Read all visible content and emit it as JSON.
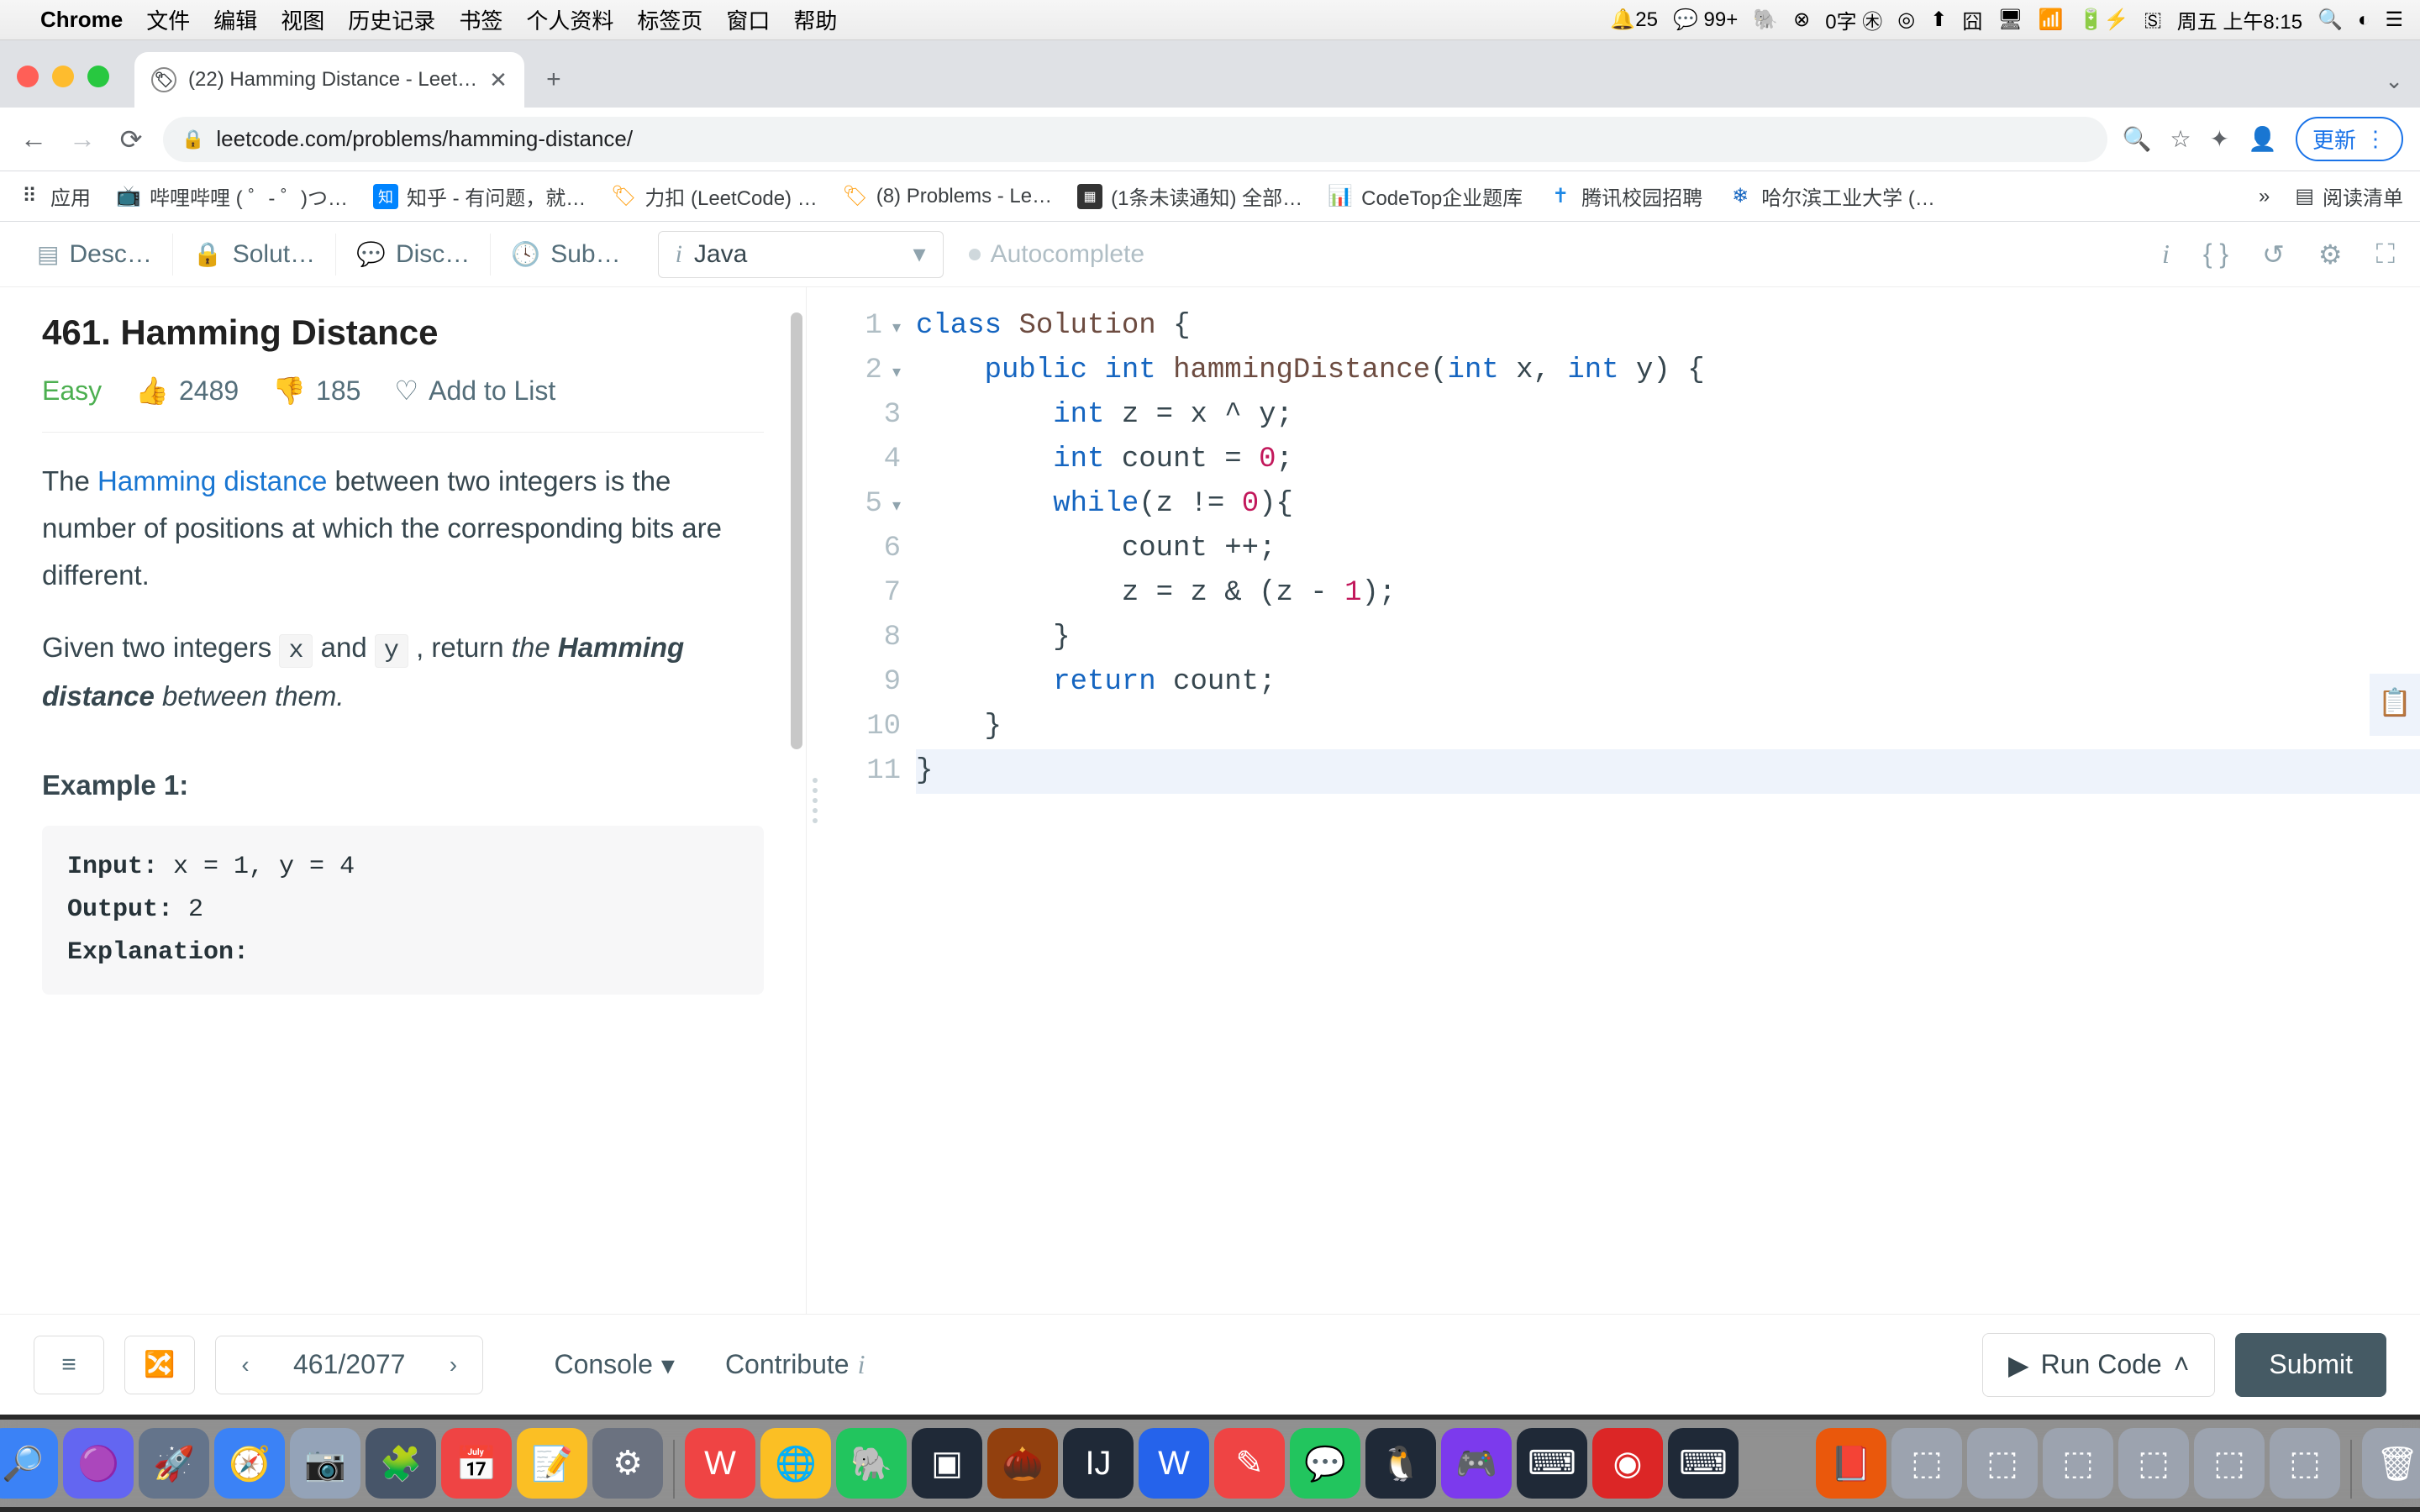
{
  "mac_menu": {
    "app": "Chrome",
    "items": [
      "文件",
      "编辑",
      "视图",
      "历史记录",
      "书签",
      "个人资料",
      "标签页",
      "窗口",
      "帮助"
    ],
    "right": [
      "🔔25",
      "💬 99+",
      "🐘",
      "⊗",
      "0字 ㊍",
      "◎",
      "⬆",
      "囧",
      "🖥",
      "📶",
      "🔋⚡",
      "🇸",
      "周五 上午8:15",
      "🔍",
      "◐",
      "☰"
    ]
  },
  "tab": {
    "title": "(22) Hamming Distance - Leet…"
  },
  "url": "leetcode.com/problems/hamming-distance/",
  "update_label": "更新",
  "bookmarks": [
    {
      "ico": "⠿",
      "label": "应用"
    },
    {
      "ico": "📺",
      "label": "哔哩哔哩 (  ゜- ゜)つ…"
    },
    {
      "ico": "知",
      "label": "知乎 - 有问题，就…"
    },
    {
      "ico": "🏷",
      "label": "力扣 (LeetCode) …"
    },
    {
      "ico": "🏷",
      "label": "(8) Problems - Le…"
    },
    {
      "ico": "▦",
      "label": "(1条未读通知) 全部…"
    },
    {
      "ico": "📊",
      "label": "CodeTop企业题库"
    },
    {
      "ico": "✝",
      "label": "腾讯校园招聘"
    },
    {
      "ico": "❄",
      "label": "哈尔滨工业大学 (…"
    }
  ],
  "bm_more": "»",
  "readlist": "阅读清单",
  "lc_tabs": {
    "desc": "Desc…",
    "solut": "Solut…",
    "disc": "Disc…",
    "sub": "Sub…"
  },
  "lang": "Java",
  "autocomplete": "Autocomplete",
  "problem": {
    "title": "461. Hamming Distance",
    "difficulty": "Easy",
    "likes": "2489",
    "dislikes": "185",
    "addlist": "Add to List",
    "p1_pre": "The ",
    "p1_link": "Hamming distance",
    "p1_post": " between two integers is the number of positions at which the corresponding bits are different.",
    "p2_a": "Given two integers ",
    "p2_x": "x",
    "p2_b": " and ",
    "p2_y": "y",
    "p2_c": " , return ",
    "p2_em1": "the ",
    "p2_strong": "Hamming distance",
    "p2_em2": " between them.",
    "example_h": "Example 1:",
    "ex_input_l": "Input:",
    "ex_input_v": " x = 1, y = 4",
    "ex_output_l": "Output:",
    "ex_output_v": " 2",
    "ex_expl_l": "Explanation:"
  },
  "code_lines": [
    {
      "n": "1",
      "fold": true,
      "html": "<span class='k-blue'>class</span> <span class='k-brown'>Solution</span> {"
    },
    {
      "n": "2",
      "fold": true,
      "html": "    <span class='k-blue'>public</span> <span class='k-blue'>int</span> <span class='k-brown'>hammingDistance</span>(<span class='k-blue'>int</span> x, <span class='k-blue'>int</span> y) {"
    },
    {
      "n": "3",
      "html": "        <span class='k-blue'>int</span> z = x ^ y;"
    },
    {
      "n": "4",
      "html": "        <span class='k-blue'>int</span> count = <span class='num'>0</span>;"
    },
    {
      "n": "5",
      "fold": true,
      "html": "        <span class='k-blue'>while</span>(z != <span class='num'>0</span>){"
    },
    {
      "n": "6",
      "html": "            count ++;"
    },
    {
      "n": "7",
      "html": "            z = z &amp; (z - <span class='num'>1</span>);"
    },
    {
      "n": "8",
      "html": "        }"
    },
    {
      "n": "9",
      "html": "        <span class='k-blue'>return</span> count;"
    },
    {
      "n": "10",
      "html": "    }"
    },
    {
      "n": "11",
      "hl": true,
      "html": "}"
    }
  ],
  "bottom": {
    "counter": "461/2077",
    "console": "Console",
    "contribute": "Contribute",
    "run": "Run Code",
    "submit": "Submit"
  },
  "dock_apps": [
    "🔎",
    "🟣",
    "🚀",
    "🧭",
    "📷",
    "🧩",
    "📅",
    "📝",
    "⚙",
    "|",
    "W",
    "🌐",
    "🐘",
    "▣",
    "🌰",
    "IJ",
    "W",
    "✎",
    "💬",
    "🐧",
    "🎮",
    "⌨",
    "◉",
    "⌨",
    "|gap|",
    "📕",
    "⬚",
    "⬚",
    "⬚",
    "⬚",
    "⬚",
    "⬚",
    "|",
    "🗑"
  ]
}
